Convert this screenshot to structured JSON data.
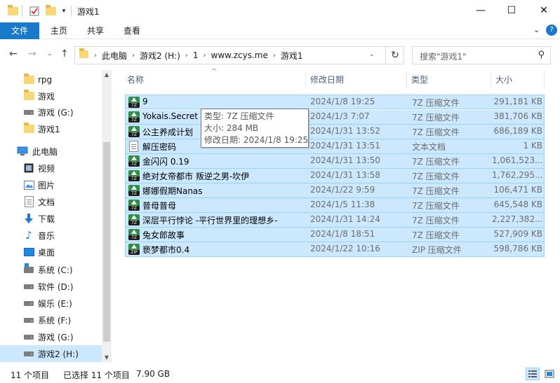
{
  "window": {
    "title": "游戏1"
  },
  "ribbon": {
    "tabs": [
      "文件",
      "主页",
      "共享",
      "查看"
    ]
  },
  "address": {
    "crumbs": [
      "此电脑",
      "游戏2 (H:)",
      "1",
      "www.zcys.me",
      "游戏1"
    ],
    "search_placeholder": "搜索\"游戏1\""
  },
  "sidebar": {
    "items": [
      {
        "label": "rpg",
        "icon": "folder-icon"
      },
      {
        "label": "游戏",
        "icon": "folder-icon"
      },
      {
        "label": "游戏 (G:)",
        "icon": "drive-icon"
      },
      {
        "label": "游戏1",
        "icon": "folder-icon"
      },
      {
        "label": "此电脑",
        "icon": "computer-icon"
      },
      {
        "label": "视频",
        "icon": "video-icon"
      },
      {
        "label": "图片",
        "icon": "pictures-icon"
      },
      {
        "label": "文档",
        "icon": "documents-icon"
      },
      {
        "label": "下载",
        "icon": "download-icon"
      },
      {
        "label": "音乐",
        "icon": "music-icon"
      },
      {
        "label": "桌面",
        "icon": "desktop-icon"
      },
      {
        "label": "系统 (C:)",
        "icon": "system-drive-icon"
      },
      {
        "label": "软件 (D:)",
        "icon": "drive-icon"
      },
      {
        "label": "娱乐 (E:)",
        "icon": "drive-icon"
      },
      {
        "label": "系统 (F:)",
        "icon": "drive-icon"
      },
      {
        "label": "游戏 (G:)",
        "icon": "drive-icon"
      },
      {
        "label": "游戏2 (H:)",
        "icon": "drive-icon"
      }
    ]
  },
  "columns": {
    "name": "名称",
    "date": "修改日期",
    "type": "类型",
    "size": "大小"
  },
  "files": [
    {
      "name": "9",
      "date": "2024/1/8 19:25",
      "type": "7Z 压缩文件",
      "size": "291,181 KB",
      "icon": "7z"
    },
    {
      "name": "Yokais.Secret",
      "date": "2024/1/3 7:07",
      "type": "7Z 压缩文件",
      "size": "381,706 KB",
      "icon": "7z"
    },
    {
      "name": "公主养成计划",
      "date": "2024/1/31 13:52",
      "type": "7Z 压缩文件",
      "size": "686,189 KB",
      "icon": "7z"
    },
    {
      "name": "解压密码",
      "date": "2024/1/31 13:51",
      "type": "文本文档",
      "size": "1 KB",
      "icon": "txt"
    },
    {
      "name": "金闪闪 0.19",
      "date": "2024/1/31 13:50",
      "type": "7Z 压缩文件",
      "size": "1,061,523...",
      "icon": "7z"
    },
    {
      "name": "绝对女帝都市 叛逆之男-坎伊",
      "date": "2024/1/31 13:58",
      "type": "7Z 压缩文件",
      "size": "1,762,295...",
      "icon": "7z"
    },
    {
      "name": "娜娜假期Nanas",
      "date": "2024/1/22 9:59",
      "type": "7Z 压缩文件",
      "size": "106,471 KB",
      "icon": "7z"
    },
    {
      "name": "普母普母",
      "date": "2024/1/5 11:38",
      "type": "7Z 压缩文件",
      "size": "645,548 KB",
      "icon": "7z"
    },
    {
      "name": "深层平行悖论 -平行世界里的理想乡-",
      "date": "2024/1/31 14:24",
      "type": "7Z 压缩文件",
      "size": "2,227,382...",
      "icon": "7z"
    },
    {
      "name": "兔女郎故事",
      "date": "2024/1/8 18:51",
      "type": "7Z 压缩文件",
      "size": "527,909 KB",
      "icon": "7z"
    },
    {
      "name": "亵梦都市0.4",
      "date": "2024/1/22 10:16",
      "type": "ZIP 压缩文件",
      "size": "598,786 KB",
      "icon": "zip"
    }
  ],
  "tooltip": {
    "type": "类型: 7Z 压缩文件",
    "size": "大小: 284 MB",
    "date": "修改日期: 2024/1/8 19:25"
  },
  "status": {
    "count": "11 个项目",
    "selected": "已选择 11 个项目",
    "total": "7.90 GB"
  },
  "colors": {
    "accent": "#1979ca",
    "selection": "#cce8ff",
    "selection_border": "#99d1ff"
  }
}
